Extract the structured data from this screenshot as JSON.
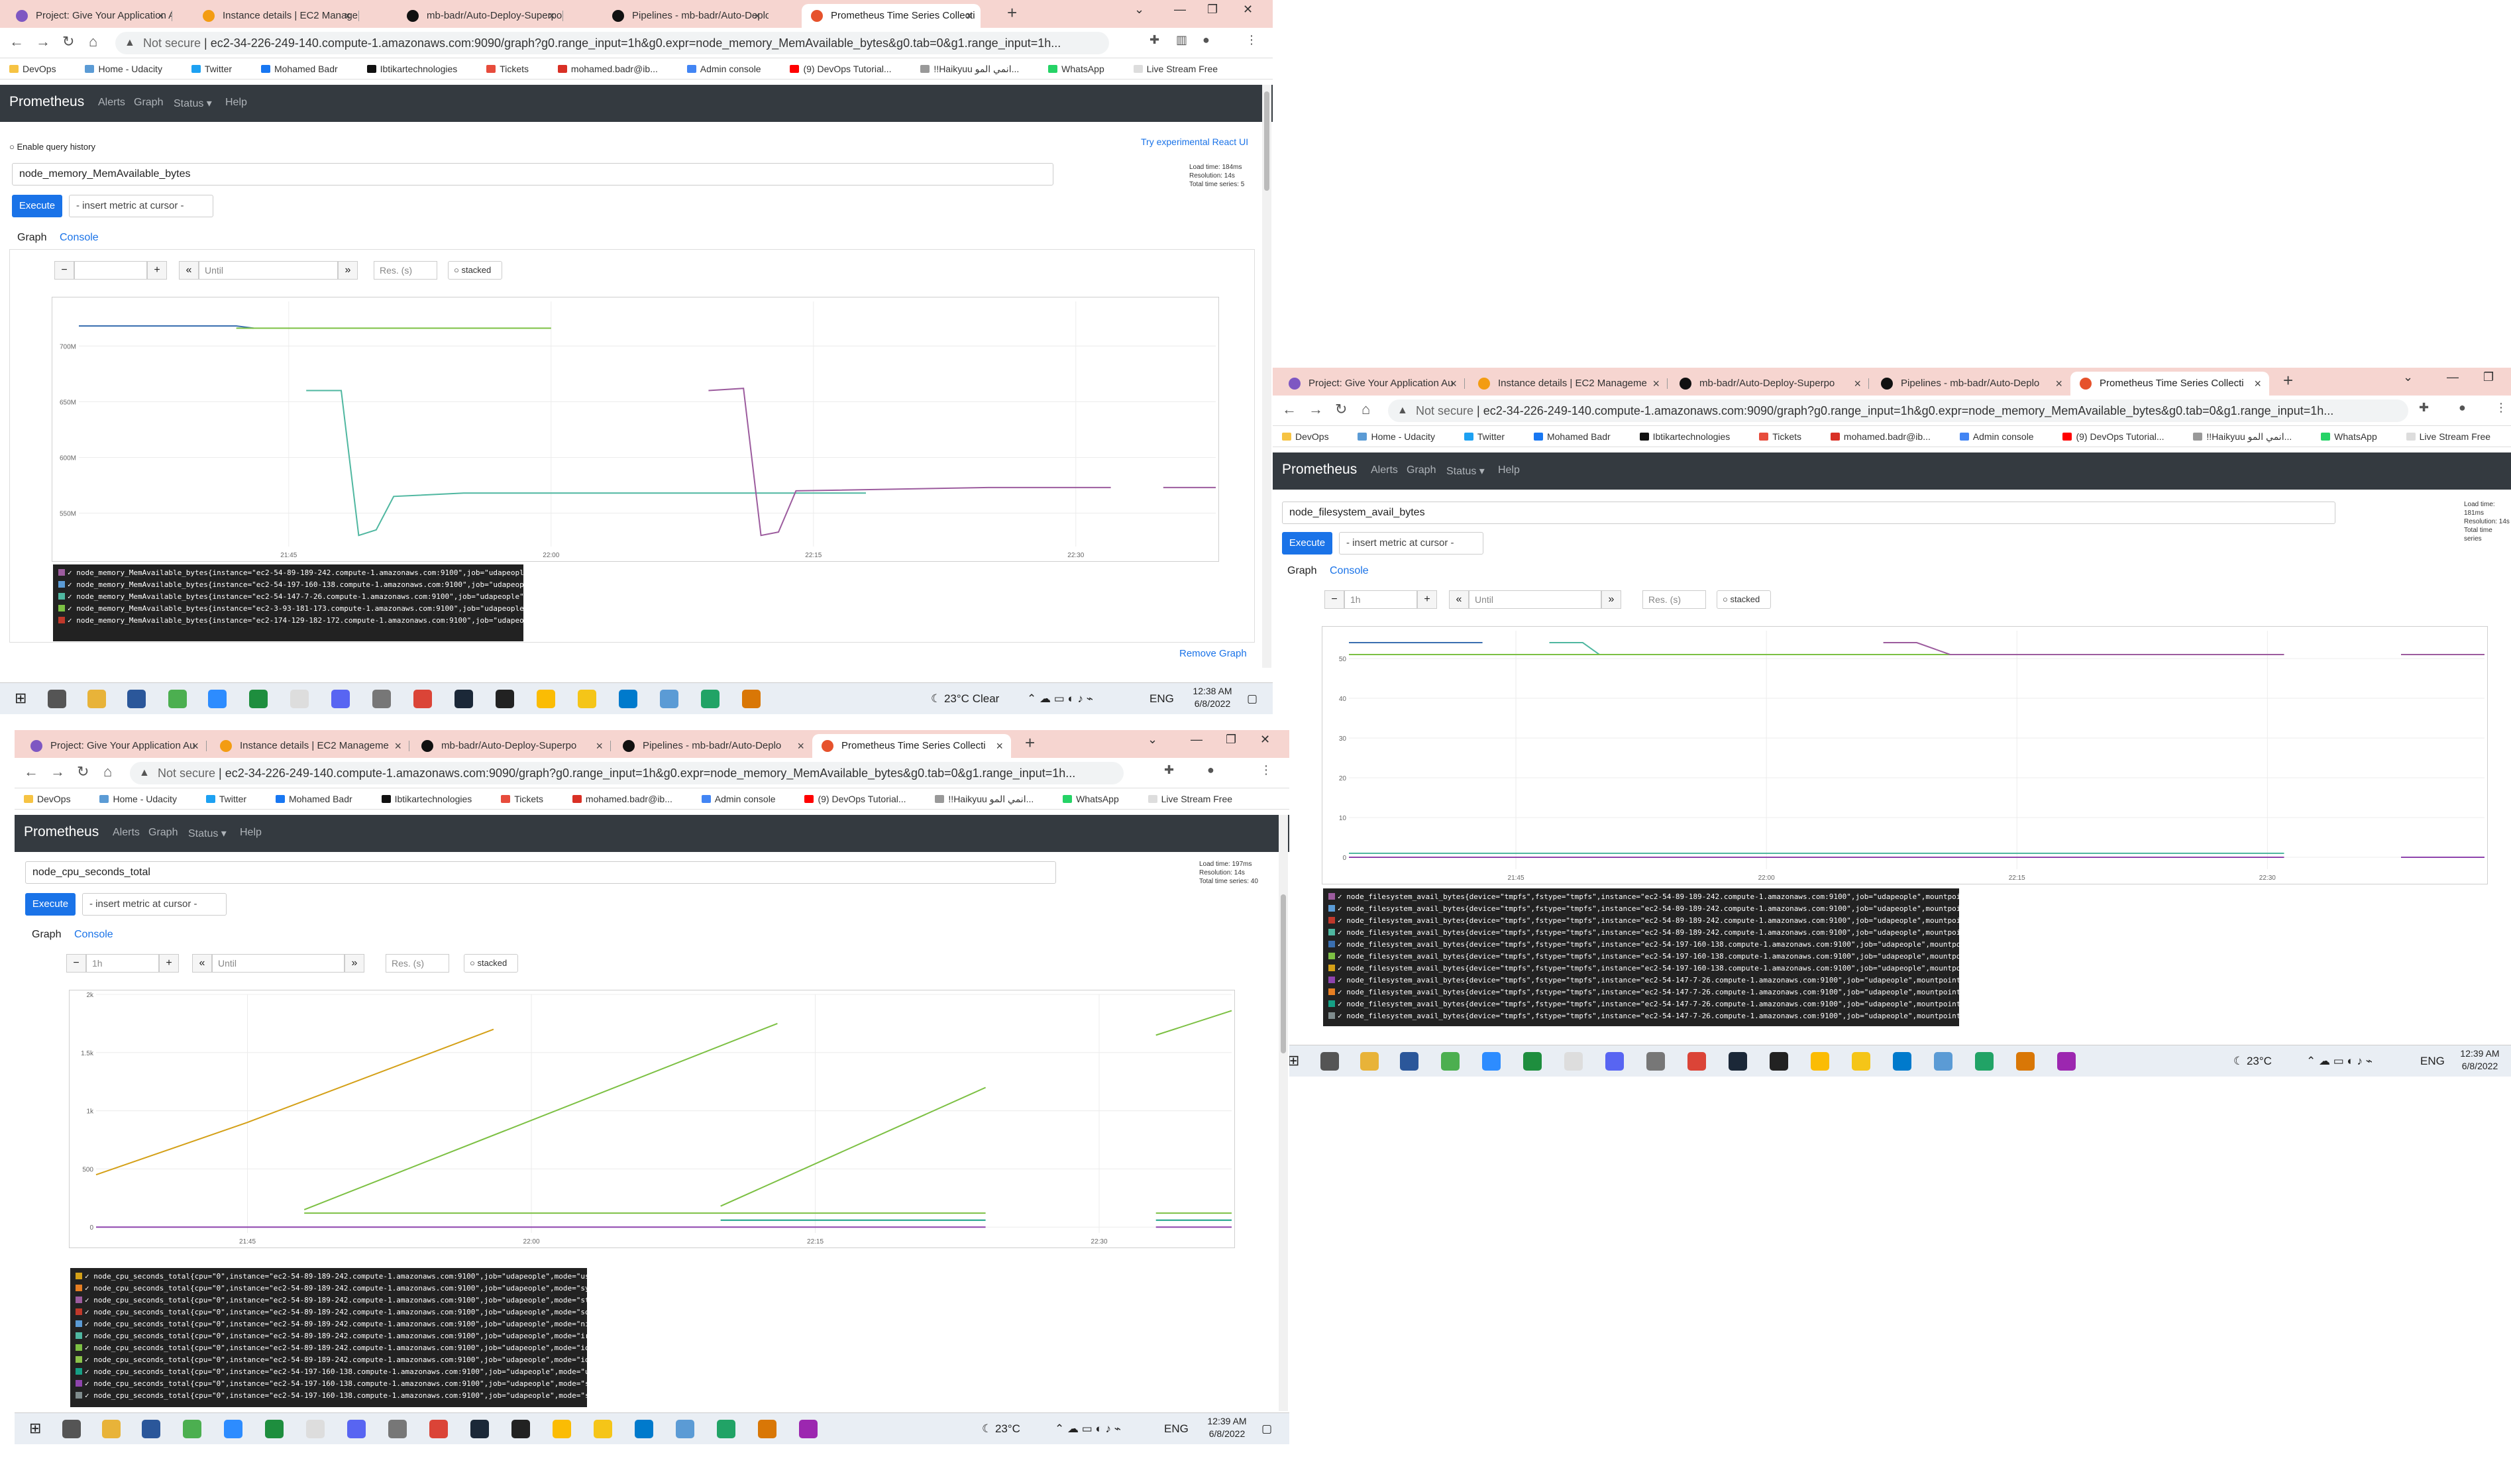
{
  "tabs": [
    "Project: Give Your Application Au",
    "Instance details | EC2 Manageme",
    "mb-badr/Auto-Deploy-Superpo",
    "Pipelines - mb-badr/Auto-Deplo",
    "Prometheus Time Series Collecti"
  ],
  "tab_colors": [
    "#7e57c2",
    "#f39c12",
    "#111111",
    "#111111",
    "#e6522c"
  ],
  "not_secure": "Not secure",
  "windows": [
    {
      "url": "ec2-34-226-249-140.compute-1.amazonaws.com:9090/graph?g0.range_input=1h&g0.expr=node_memory_MemAvailable_bytes&g0.tab=0&g1.range_input=1h..."
    },
    {
      "url": "ec2-34-226-249-140.compute-1.amazonaws.com:9090/graph?g0.range_input=1h&g0.expr=node_memory_MemAvailable_bytes&g0.tab=0&g1.range_input=1h..."
    },
    {
      "url": "ec2-34-226-249-140.compute-1.amazonaws.com:9090/graph?g0.range_input=1h&g0.expr=node_memory_MemAvailable_bytes&g0.tab=0&g1.range_input=1h..."
    }
  ],
  "bookmarks": [
    "DevOps",
    "Home - Udacity",
    "Twitter",
    "Mohamed Badr",
    "Ibtikartechnologies",
    "Tickets",
    "mohamed.badr@ib...",
    "Admin console",
    "(9) DevOps Tutorial...",
    "!!Haikyuu انمي المو...",
    "WhatsApp",
    "Live Stream Free"
  ],
  "prom": {
    "brand": "Prometheus",
    "alerts": "Alerts",
    "graph": "Graph",
    "status": "Status ▾",
    "help": "Help",
    "enable_history": "Enable query history",
    "react_ui": "Try experimental React UI",
    "execute": "Execute",
    "insert_metric": "- insert metric at cursor -",
    "tab_graph": "Graph",
    "tab_console": "Console",
    "range": "1h",
    "until": "Until",
    "res": "Res. (s)",
    "stacked": "stacked",
    "remove_graph": "Remove Graph"
  },
  "panel1": {
    "expr": "node_memory_MemAvailable_bytes",
    "load_time": "Load time: 184ms",
    "resolution": "Resolution: 14s",
    "total_series": "Total time series: 5",
    "y_ticks": [
      "700M",
      "650M",
      "600M",
      "550M"
    ],
    "x_ticks": [
      "21:45",
      "22:00",
      "22:15",
      "22:30"
    ],
    "legend": [
      {
        "text": "node_memory_MemAvailable_bytes{instance=\"ec2-54-89-189-242.compute-1.amazonaws.com:9100\",job=\"udapeople\"}",
        "color": "#9c5c9e"
      },
      {
        "text": "node_memory_MemAvailable_bytes{instance=\"ec2-54-197-160-138.compute-1.amazonaws.com:9100\",job=\"udapeople\"}",
        "color": "#5b9bd5"
      },
      {
        "text": "node_memory_MemAvailable_bytes{instance=\"ec2-54-147-7-26.compute-1.amazonaws.com:9100\",job=\"udapeople\"}",
        "color": "#4fb7a0"
      },
      {
        "text": "node_memory_MemAvailable_bytes{instance=\"ec2-3-93-181-173.compute-1.amazonaws.com:9100\",job=\"udapeople\"}",
        "color": "#7cc043"
      },
      {
        "text": "node_memory_MemAvailable_bytes{instance=\"ec2-174-129-182-172.compute-1.amazonaws.com:9100\",job=\"udapeople\"}",
        "color": "#c0392b"
      }
    ]
  },
  "panel2": {
    "expr": "node_filesystem_avail_bytes",
    "load_time": "Load time: 181ms",
    "resolution": "Resolution: 14s",
    "total_series": "Total time series",
    "y_ticks": [
      "50",
      "40",
      "30",
      "20",
      "10",
      "0"
    ],
    "x_ticks": [
      "21:45",
      "22:00",
      "22:15",
      "22:30"
    ],
    "legend": [
      {
        "text": "node_filesystem_avail_bytes{device=\"tmpfs\",fstype=\"tmpfs\",instance=\"ec2-54-89-189-242.compute-1.amazonaws.com:9100\",job=\"udapeople\",mountpoint=\"/run/user/1000\"}",
        "color": "#9c5c9e"
      },
      {
        "text": "node_filesystem_avail_bytes{device=\"tmpfs\",fstype=\"tmpfs\",instance=\"ec2-54-89-189-242.compute-1.amazonaws.com:9100\",job=\"udapeople\",mountpoint=\"/run/snapd/ns\"}",
        "color": "#5b9bd5"
      },
      {
        "text": "node_filesystem_avail_bytes{device=\"tmpfs\",fstype=\"tmpfs\",instance=\"ec2-54-89-189-242.compute-1.amazonaws.com:9100\",job=\"udapeople\",mountpoint=\"/run/lock\"}",
        "color": "#c0392b"
      },
      {
        "text": "node_filesystem_avail_bytes{device=\"tmpfs\",fstype=\"tmpfs\",instance=\"ec2-54-89-189-242.compute-1.amazonaws.com:9100\",job=\"udapeople\",mountpoint=\"/run\"}",
        "color": "#4fb7a0"
      },
      {
        "text": "node_filesystem_avail_bytes{device=\"tmpfs\",fstype=\"tmpfs\",instance=\"ec2-54-197-160-138.compute-1.amazonaws.com:9100\",job=\"udapeople\",mountpoint=\"/run/snapd/ns\"}",
        "color": "#3a6fb0"
      },
      {
        "text": "node_filesystem_avail_bytes{device=\"tmpfs\",fstype=\"tmpfs\",instance=\"ec2-54-197-160-138.compute-1.amazonaws.com:9100\",job=\"udapeople\",mountpoint=\"/run/lock\"}",
        "color": "#7cc043"
      },
      {
        "text": "node_filesystem_avail_bytes{device=\"tmpfs\",fstype=\"tmpfs\",instance=\"ec2-54-197-160-138.compute-1.amazonaws.com:9100\",job=\"udapeople\",mountpoint=\"/run\"}",
        "color": "#d4a017"
      },
      {
        "text": "node_filesystem_avail_bytes{device=\"tmpfs\",fstype=\"tmpfs\",instance=\"ec2-54-147-7-26.compute-1.amazonaws.com:9100\",job=\"udapeople\",mountpoint=\"/run/user/1000\"}",
        "color": "#8e44ad"
      },
      {
        "text": "node_filesystem_avail_bytes{device=\"tmpfs\",fstype=\"tmpfs\",instance=\"ec2-54-147-7-26.compute-1.amazonaws.com:9100\",job=\"udapeople\",mountpoint=\"/run/snapd/ns\"}",
        "color": "#e67e22"
      },
      {
        "text": "node_filesystem_avail_bytes{device=\"tmpfs\",fstype=\"tmpfs\",instance=\"ec2-54-147-7-26.compute-1.amazonaws.com:9100\",job=\"udapeople\",mountpoint=\"/run/lock\"}",
        "color": "#16a085"
      },
      {
        "text": "node_filesystem_avail_bytes{device=\"tmpfs\",fstype=\"tmpfs\",instance=\"ec2-54-147-7-26.compute-1.amazonaws.com:9100\",job=\"udapeople\",mountpoint=\"/run\"}",
        "color": "#7f8c8d"
      }
    ]
  },
  "panel3": {
    "expr": "node_cpu_seconds_total",
    "load_time": "Load time: 197ms",
    "resolution": "Resolution: 14s",
    "total_series": "Total time series: 40",
    "y_ticks": [
      "2k",
      "1.5k",
      "1k",
      "500",
      "0"
    ],
    "x_ticks": [
      "21:45",
      "22:00",
      "22:15",
      "22:30"
    ],
    "legend": [
      {
        "text": "node_cpu_seconds_total{cpu=\"0\",instance=\"ec2-54-89-189-242.compute-1.amazonaws.com:9100\",job=\"udapeople\",mode=\"user\"}",
        "color": "#d4a017"
      },
      {
        "text": "node_cpu_seconds_total{cpu=\"0\",instance=\"ec2-54-89-189-242.compute-1.amazonaws.com:9100\",job=\"udapeople\",mode=\"system\"}",
        "color": "#e67e22"
      },
      {
        "text": "node_cpu_seconds_total{cpu=\"0\",instance=\"ec2-54-89-189-242.compute-1.amazonaws.com:9100\",job=\"udapeople\",mode=\"steal\"}",
        "color": "#9c5c9e"
      },
      {
        "text": "node_cpu_seconds_total{cpu=\"0\",instance=\"ec2-54-89-189-242.compute-1.amazonaws.com:9100\",job=\"udapeople\",mode=\"softirq\"}",
        "color": "#c0392b"
      },
      {
        "text": "node_cpu_seconds_total{cpu=\"0\",instance=\"ec2-54-89-189-242.compute-1.amazonaws.com:9100\",job=\"udapeople\",mode=\"nice\"}",
        "color": "#5b9bd5"
      },
      {
        "text": "node_cpu_seconds_total{cpu=\"0\",instance=\"ec2-54-89-189-242.compute-1.amazonaws.com:9100\",job=\"udapeople\",mode=\"irq\"}",
        "color": "#4fb7a0"
      },
      {
        "text": "node_cpu_seconds_total{cpu=\"0\",instance=\"ec2-54-89-189-242.compute-1.amazonaws.com:9100\",job=\"udapeople\",mode=\"iowait\"}",
        "color": "#7cc043"
      },
      {
        "text": "node_cpu_seconds_total{cpu=\"0\",instance=\"ec2-54-89-189-242.compute-1.amazonaws.com:9100\",job=\"udapeople\",mode=\"idle\"}",
        "color": "#8bc34a"
      },
      {
        "text": "node_cpu_seconds_total{cpu=\"0\",instance=\"ec2-54-197-160-138.compute-1.amazonaws.com:9100\",job=\"udapeople\",mode=\"user\"}",
        "color": "#16a085"
      },
      {
        "text": "node_cpu_seconds_total{cpu=\"0\",instance=\"ec2-54-197-160-138.compute-1.amazonaws.com:9100\",job=\"udapeople\",mode=\"system\"}",
        "color": "#8e44ad"
      },
      {
        "text": "node_cpu_seconds_total{cpu=\"0\",instance=\"ec2-54-197-160-138.compute-1.amazonaws.com:9100\",job=\"udapeople\",mode=\"steal\"}",
        "color": "#7f8c8d"
      }
    ]
  },
  "taskbars": [
    {
      "temp": "23°C",
      "weather": "Clear",
      "lang": "ENG",
      "time": "12:38 AM",
      "date": "6/8/2022"
    },
    {
      "temp": "23°C",
      "weather": "",
      "lang": "ENG",
      "time": "12:39 AM",
      "date": "6/8/2022"
    },
    {
      "temp": "23°C",
      "weather": "",
      "lang": "ENG",
      "time": "12:39 AM",
      "date": "6/8/2022"
    }
  ],
  "chart_data": [
    {
      "type": "line",
      "title": "node_memory_MemAvailable_bytes",
      "x_ticks": [
        "21:45",
        "22:00",
        "22:15",
        "22:30"
      ],
      "y_ticks": [
        "550M",
        "600M",
        "650M",
        "700M"
      ],
      "ylim": [
        520,
        740
      ],
      "xlim": [
        "21:33",
        "22:38"
      ],
      "series": [
        {
          "color": "#3a6fb0",
          "points": [
            [
              "21:33",
              718
            ],
            [
              "21:42",
              718
            ],
            [
              "21:43",
              716
            ]
          ]
        },
        {
          "color": "#7cc043",
          "points": [
            [
              "21:42",
              716
            ],
            [
              "22:00",
              716
            ]
          ]
        },
        {
          "color": "#4fb7a0",
          "points": [
            [
              "21:46",
              660
            ],
            [
              "21:48",
              660
            ],
            [
              "21:49",
              530
            ],
            [
              "21:50",
              535
            ],
            [
              "21:51",
              565
            ],
            [
              "21:55",
              568
            ],
            [
              "22:07",
              568
            ],
            [
              "22:18",
              568
            ]
          ]
        },
        {
          "color": "#9c5c9e",
          "points": [
            [
              "22:09",
              660
            ],
            [
              "22:11",
              662
            ],
            [
              "22:12",
              530
            ],
            [
              "22:13",
              533
            ],
            [
              "22:14",
              570
            ],
            [
              "22:25",
              573
            ],
            [
              "22:32",
              573
            ]
          ]
        },
        {
          "color": "#9c5c9e",
          "points": [
            [
              "22:35",
              573
            ],
            [
              "22:38",
              573
            ]
          ]
        }
      ]
    },
    {
      "type": "line",
      "title": "node_filesystem_avail_bytes",
      "x_ticks": [
        "21:45",
        "22:00",
        "22:15",
        "22:30"
      ],
      "y_ticks": [
        "0",
        "10",
        "20",
        "30",
        "40",
        "50"
      ],
      "ylim": [
        -3,
        57
      ],
      "xlim": [
        "21:35",
        "22:43"
      ],
      "series": [
        {
          "color": "#3a6fb0",
          "points": [
            [
              "21:35",
              54
            ],
            [
              "21:43",
              54
            ]
          ]
        },
        {
          "color": "#4fb7a0",
          "points": [
            [
              "21:47",
              54
            ],
            [
              "21:49",
              54
            ],
            [
              "21:50",
              51
            ],
            [
              "22:00",
              51
            ]
          ]
        },
        {
          "color": "#7cc043",
          "points": [
            [
              "21:35",
              51
            ],
            [
              "22:15",
              51
            ]
          ]
        },
        {
          "color": "#9c5c9e",
          "points": [
            [
              "22:07",
              54
            ],
            [
              "22:09",
              54
            ],
            [
              "22:11",
              51
            ],
            [
              "22:31",
              51
            ]
          ]
        },
        {
          "color": "#9c5c9e",
          "points": [
            [
              "22:38",
              51
            ],
            [
              "22:43",
              51
            ]
          ]
        },
        {
          "color": "#4fb7a0",
          "points": [
            [
              "21:35",
              1
            ],
            [
              "22:31",
              1
            ]
          ]
        },
        {
          "color": "#8e44ad",
          "points": [
            [
              "21:35",
              0
            ],
            [
              "22:31",
              0
            ]
          ]
        },
        {
          "color": "#8e44ad",
          "points": [
            [
              "22:38",
              0
            ],
            [
              "22:43",
              0
            ]
          ]
        }
      ]
    },
    {
      "type": "line",
      "title": "node_cpu_seconds_total",
      "x_ticks": [
        "21:45",
        "22:00",
        "22:15",
        "22:30"
      ],
      "y_ticks": [
        "0",
        "500",
        "1k",
        "1.5k",
        "2k"
      ],
      "ylim": [
        -50,
        2000
      ],
      "xlim": [
        "21:37",
        "22:37"
      ],
      "series": [
        {
          "color": "#d4a017",
          "points": [
            [
              "21:37",
              450
            ],
            [
              "21:45",
              900
            ],
            [
              "21:58",
              1700
            ]
          ]
        },
        {
          "color": "#7cc043",
          "points": [
            [
              "21:48",
              150
            ],
            [
              "22:13",
              1750
            ]
          ]
        },
        {
          "color": "#7cc043",
          "points": [
            [
              "22:10",
              180
            ],
            [
              "22:24",
              1200
            ]
          ]
        },
        {
          "color": "#7cc043",
          "points": [
            [
              "22:33",
              1650
            ],
            [
              "22:37",
              1860
            ]
          ]
        },
        {
          "color": "#7cc043",
          "points": [
            [
              "21:48",
              120
            ],
            [
              "22:24",
              120
            ]
          ]
        },
        {
          "color": "#16a085",
          "points": [
            [
              "22:10",
              60
            ],
            [
              "22:24",
              60
            ]
          ]
        },
        {
          "color": "#8e44ad",
          "points": [
            [
              "21:37",
              0
            ],
            [
              "22:24",
              0
            ]
          ]
        },
        {
          "color": "#7cc043",
          "points": [
            [
              "22:33",
              120
            ],
            [
              "22:37",
              120
            ]
          ]
        },
        {
          "color": "#16a085",
          "points": [
            [
              "22:33",
              60
            ],
            [
              "22:37",
              60
            ]
          ]
        },
        {
          "color": "#8e44ad",
          "points": [
            [
              "22:33",
              0
            ],
            [
              "22:37",
              0
            ]
          ]
        }
      ]
    }
  ]
}
